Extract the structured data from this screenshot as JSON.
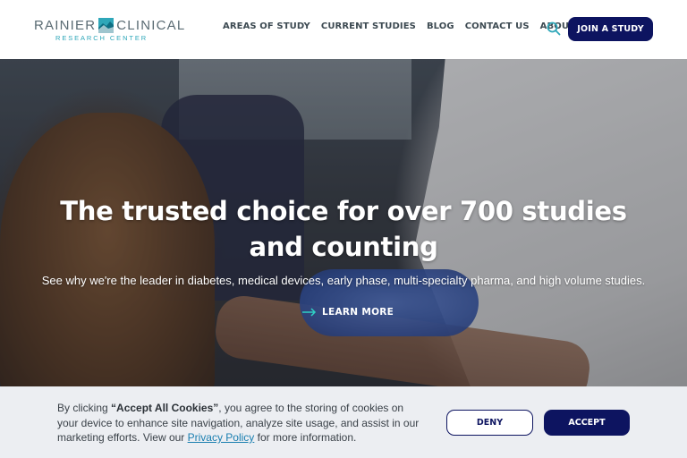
{
  "header": {
    "logo": {
      "word_left": "RAINIER",
      "word_right": "CLINICAL",
      "subline": "RESEARCH CENTER",
      "mark_icon": "mountain-square-logo-icon"
    },
    "nav": [
      {
        "label": "AREAS OF STUDY"
      },
      {
        "label": "CURRENT STUDIES"
      },
      {
        "label": "BLOG"
      },
      {
        "label": "CONTACT US"
      },
      {
        "label": "ABOUT",
        "icon": "chevron-down-icon"
      }
    ],
    "search_icon": "search-icon",
    "cta_label": "JOIN A STUDY"
  },
  "hero": {
    "title": "The trusted choice for over 700 studies and counting",
    "subtitle": "See why we're the leader in diabetes, medical devices, early phase, multi-specialty pharma, and high volume studies.",
    "link_label": "LEARN MORE",
    "link_icon": "arrow-right-icon"
  },
  "cookie_banner": {
    "text_prefix": "By clicking ",
    "text_bold": "“Accept All Cookies”",
    "text_middle": ", you agree to the storing of cookies on your device to enhance site navigation, analyze site usage, and assist in our marketing efforts. View our ",
    "link_label": "Privacy Policy",
    "text_suffix": " for more information.",
    "deny_label": "DENY",
    "accept_label": "ACCEPT"
  },
  "colors": {
    "brand_navy": "#0d1460",
    "brand_teal": "#2fa7b9",
    "nav_text": "#3d4a52",
    "banner_bg": "#eceef2"
  }
}
